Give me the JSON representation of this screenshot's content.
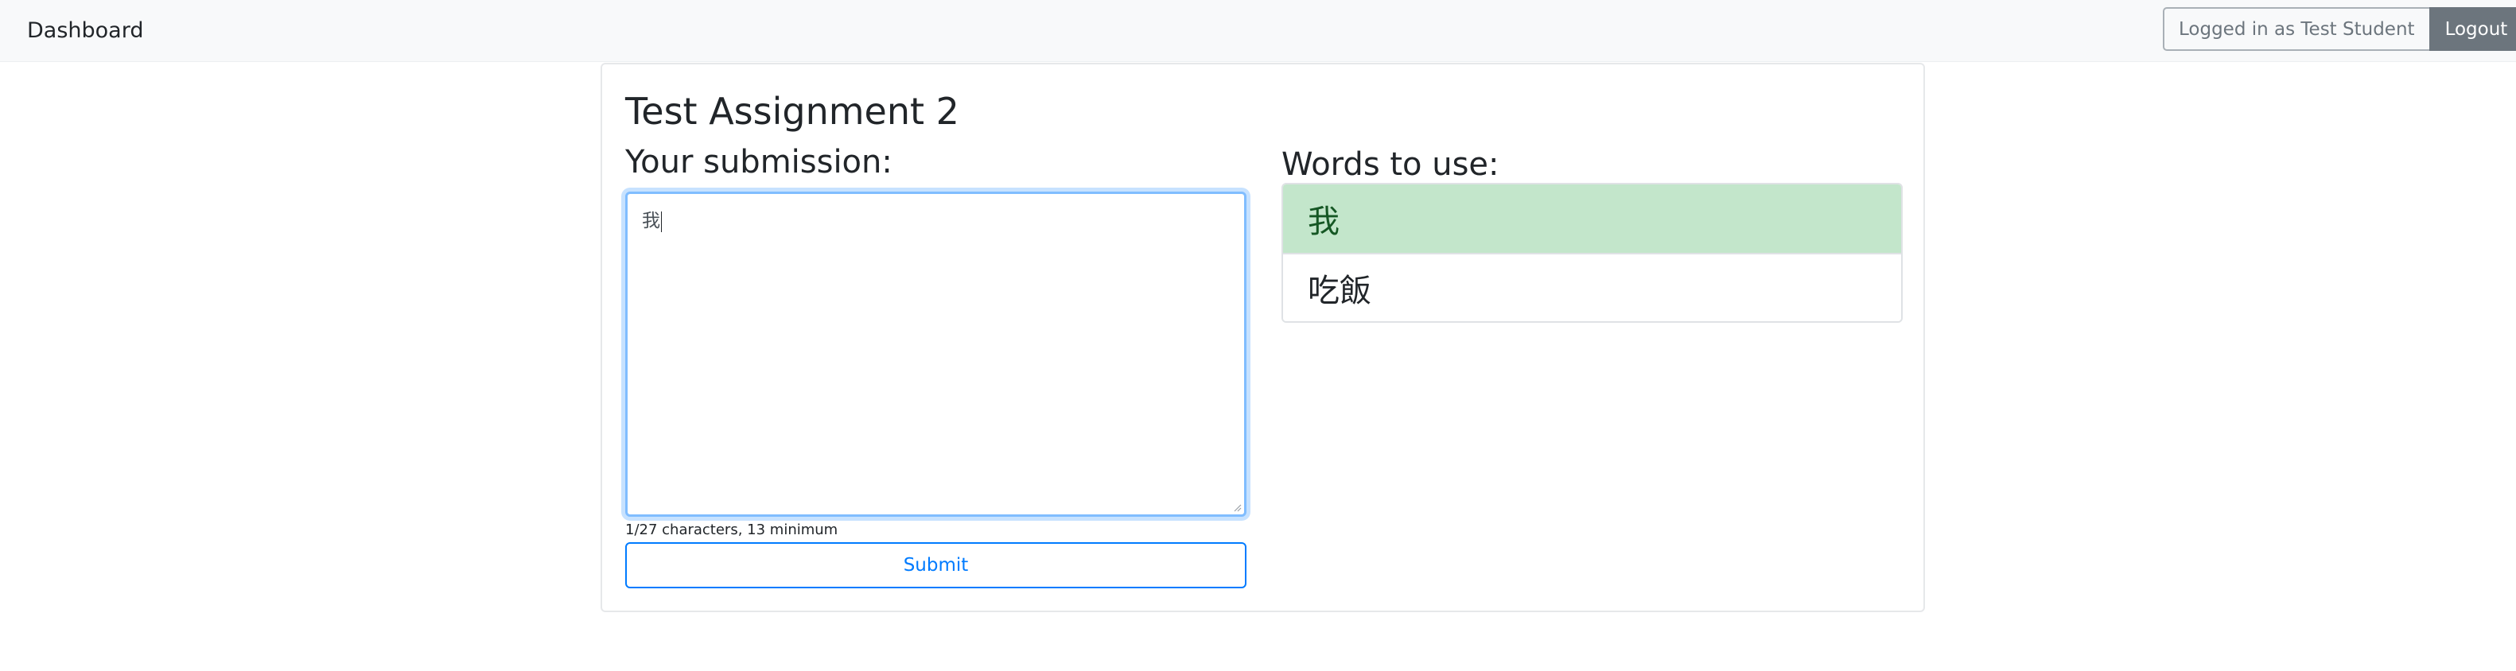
{
  "navbar": {
    "brand": "Dashboard",
    "logged_in_label": "Logged in as Test Student",
    "logout_label": "Logout"
  },
  "assignment": {
    "title": "Test Assignment 2",
    "submission_heading": "Your submission:",
    "submission_text": "我",
    "char_counter": "1/27 characters, 13 minimum",
    "submit_label": "Submit",
    "words_heading": "Words to use:",
    "words": [
      {
        "text": "我",
        "used": true
      },
      {
        "text": "吃飯",
        "used": false
      }
    ]
  },
  "colors": {
    "navbar_bg": "#f8f9fa",
    "primary": "#007bff",
    "secondary": "#6c757d",
    "used_word_bg": "#c3e6cb",
    "used_word_text": "#155724"
  }
}
